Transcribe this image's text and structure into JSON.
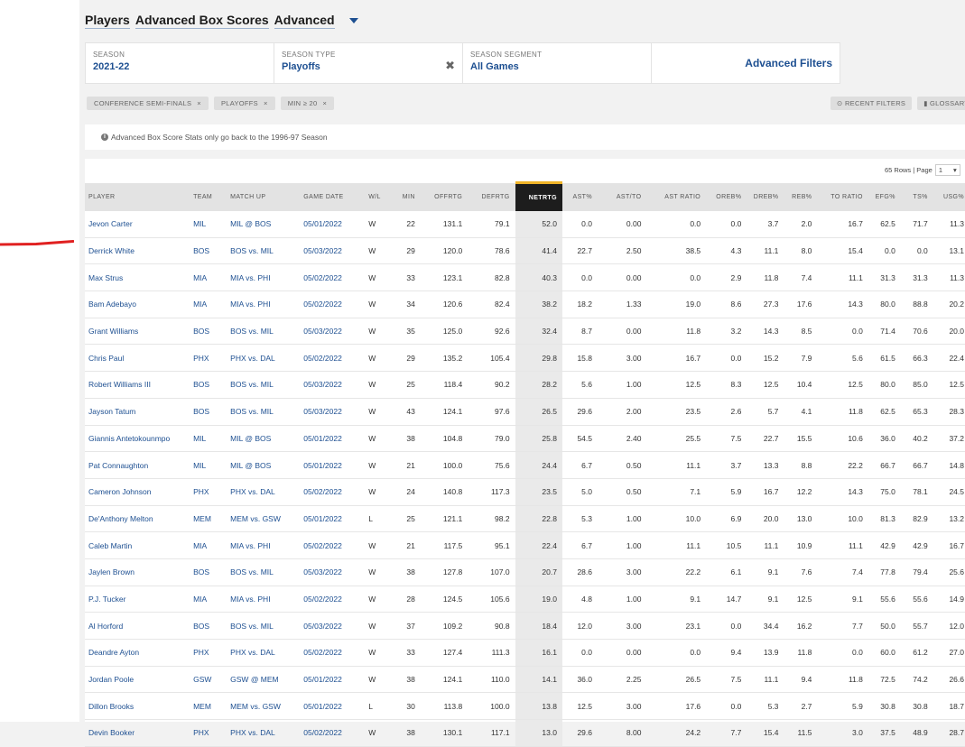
{
  "breadcrumbs": [
    "Players",
    "Advanced Box Scores",
    "Advanced"
  ],
  "filters": [
    {
      "label": "SEASON",
      "value": "2021-22"
    },
    {
      "label": "SEASON TYPE",
      "value": "Playoffs",
      "clear": "✖"
    },
    {
      "label": "SEASON SEGMENT",
      "value": "All Games"
    }
  ],
  "advanced_filters_label": "Advanced Filters",
  "chips": [
    "CONFERENCE SEMI-FINALS",
    "PLAYOFFS",
    "MIN ≥ 20"
  ],
  "chip_close": "×",
  "recent_filters_label": "⊙ RECENT FILTERS",
  "glossary_label": "▮ GLOSSARY",
  "note_icon": "i",
  "note": "Advanced Box Score Stats only go back to the 1996-97 Season",
  "pager": {
    "rows_text": "65 Rows | Page",
    "page": "1",
    "caret": "▾"
  },
  "columns": [
    "PLAYER",
    "TEAM",
    "MATCH UP",
    "GAME DATE",
    "W/L",
    "MIN",
    "OFFRTG",
    "DEFRTG",
    "NETRTG",
    "AST%",
    "AST/TO",
    "AST RATIO",
    "OREB%",
    "DREB%",
    "REB%",
    "TO RATIO",
    "EFG%",
    "TS%",
    "USG%"
  ],
  "rows": [
    [
      "Jevon Carter",
      "MIL",
      "MIL @ BOS",
      "05/01/2022",
      "W",
      "22",
      "131.1",
      "79.1",
      "52.0",
      "0.0",
      "0.00",
      "0.0",
      "0.0",
      "3.7",
      "2.0",
      "16.7",
      "62.5",
      "71.7",
      "11.3"
    ],
    [
      "Derrick White",
      "BOS",
      "BOS vs. MIL",
      "05/03/2022",
      "W",
      "29",
      "120.0",
      "78.6",
      "41.4",
      "22.7",
      "2.50",
      "38.5",
      "4.3",
      "11.1",
      "8.0",
      "15.4",
      "0.0",
      "0.0",
      "13.1"
    ],
    [
      "Max Strus",
      "MIA",
      "MIA vs. PHI",
      "05/02/2022",
      "W",
      "33",
      "123.1",
      "82.8",
      "40.3",
      "0.0",
      "0.00",
      "0.0",
      "2.9",
      "11.8",
      "7.4",
      "11.1",
      "31.3",
      "31.3",
      "11.3"
    ],
    [
      "Bam Adebayo",
      "MIA",
      "MIA vs. PHI",
      "05/02/2022",
      "W",
      "34",
      "120.6",
      "82.4",
      "38.2",
      "18.2",
      "1.33",
      "19.0",
      "8.6",
      "27.3",
      "17.6",
      "14.3",
      "80.0",
      "88.8",
      "20.2"
    ],
    [
      "Grant Williams",
      "BOS",
      "BOS vs. MIL",
      "05/03/2022",
      "W",
      "35",
      "125.0",
      "92.6",
      "32.4",
      "8.7",
      "0.00",
      "11.8",
      "3.2",
      "14.3",
      "8.5",
      "0.0",
      "71.4",
      "70.6",
      "20.0"
    ],
    [
      "Chris Paul",
      "PHX",
      "PHX vs. DAL",
      "05/02/2022",
      "W",
      "29",
      "135.2",
      "105.4",
      "29.8",
      "15.8",
      "3.00",
      "16.7",
      "0.0",
      "15.2",
      "7.9",
      "5.6",
      "61.5",
      "66.3",
      "22.4"
    ],
    [
      "Robert Williams III",
      "BOS",
      "BOS vs. MIL",
      "05/03/2022",
      "W",
      "25",
      "118.4",
      "90.2",
      "28.2",
      "5.6",
      "1.00",
      "12.5",
      "8.3",
      "12.5",
      "10.4",
      "12.5",
      "80.0",
      "85.0",
      "12.5"
    ],
    [
      "Jayson Tatum",
      "BOS",
      "BOS vs. MIL",
      "05/03/2022",
      "W",
      "43",
      "124.1",
      "97.6",
      "26.5",
      "29.6",
      "2.00",
      "23.5",
      "2.6",
      "5.7",
      "4.1",
      "11.8",
      "62.5",
      "65.3",
      "28.3"
    ],
    [
      "Giannis Antetokounmpo",
      "MIL",
      "MIL @ BOS",
      "05/01/2022",
      "W",
      "38",
      "104.8",
      "79.0",
      "25.8",
      "54.5",
      "2.40",
      "25.5",
      "7.5",
      "22.7",
      "15.5",
      "10.6",
      "36.0",
      "40.2",
      "37.2"
    ],
    [
      "Pat Connaughton",
      "MIL",
      "MIL @ BOS",
      "05/01/2022",
      "W",
      "21",
      "100.0",
      "75.6",
      "24.4",
      "6.7",
      "0.50",
      "11.1",
      "3.7",
      "13.3",
      "8.8",
      "22.2",
      "66.7",
      "66.7",
      "14.8"
    ],
    [
      "Cameron Johnson",
      "PHX",
      "PHX vs. DAL",
      "05/02/2022",
      "W",
      "24",
      "140.8",
      "117.3",
      "23.5",
      "5.0",
      "0.50",
      "7.1",
      "5.9",
      "16.7",
      "12.2",
      "14.3",
      "75.0",
      "78.1",
      "24.5"
    ],
    [
      "De'Anthony Melton",
      "MEM",
      "MEM vs. GSW",
      "05/01/2022",
      "L",
      "25",
      "121.1",
      "98.2",
      "22.8",
      "5.3",
      "1.00",
      "10.0",
      "6.9",
      "20.0",
      "13.0",
      "10.0",
      "81.3",
      "82.9",
      "13.2"
    ],
    [
      "Caleb Martin",
      "MIA",
      "MIA vs. PHI",
      "05/02/2022",
      "W",
      "21",
      "117.5",
      "95.1",
      "22.4",
      "6.7",
      "1.00",
      "11.1",
      "10.5",
      "11.1",
      "10.9",
      "11.1",
      "42.9",
      "42.9",
      "16.7"
    ],
    [
      "Jaylen Brown",
      "BOS",
      "BOS vs. MIL",
      "05/03/2022",
      "W",
      "38",
      "127.8",
      "107.0",
      "20.7",
      "28.6",
      "3.00",
      "22.2",
      "6.1",
      "9.1",
      "7.6",
      "7.4",
      "77.8",
      "79.4",
      "25.6"
    ],
    [
      "P.J. Tucker",
      "MIA",
      "MIA vs. PHI",
      "05/02/2022",
      "W",
      "28",
      "124.5",
      "105.6",
      "19.0",
      "4.8",
      "1.00",
      "9.1",
      "14.7",
      "9.1",
      "12.5",
      "9.1",
      "55.6",
      "55.6",
      "14.9"
    ],
    [
      "Al Horford",
      "BOS",
      "BOS vs. MIL",
      "05/03/2022",
      "W",
      "37",
      "109.2",
      "90.8",
      "18.4",
      "12.0",
      "3.00",
      "23.1",
      "0.0",
      "34.4",
      "16.2",
      "7.7",
      "50.0",
      "55.7",
      "12.0"
    ],
    [
      "Deandre Ayton",
      "PHX",
      "PHX vs. DAL",
      "05/02/2022",
      "W",
      "33",
      "127.4",
      "111.3",
      "16.1",
      "0.0",
      "0.00",
      "0.0",
      "9.4",
      "13.9",
      "11.8",
      "0.0",
      "60.0",
      "61.2",
      "27.0"
    ],
    [
      "Jordan Poole",
      "GSW",
      "GSW @ MEM",
      "05/01/2022",
      "W",
      "38",
      "124.1",
      "110.0",
      "14.1",
      "36.0",
      "2.25",
      "26.5",
      "7.5",
      "11.1",
      "9.4",
      "11.8",
      "72.5",
      "74.2",
      "26.6"
    ],
    [
      "Dillon Brooks",
      "MEM",
      "MEM vs. GSW",
      "05/01/2022",
      "L",
      "30",
      "113.8",
      "100.0",
      "13.8",
      "12.5",
      "3.00",
      "17.6",
      "0.0",
      "5.3",
      "2.7",
      "5.9",
      "30.8",
      "30.8",
      "18.7"
    ],
    [
      "Devin Booker",
      "PHX",
      "PHX vs. DAL",
      "05/02/2022",
      "W",
      "38",
      "130.1",
      "117.1",
      "13.0",
      "29.6",
      "8.00",
      "24.2",
      "7.7",
      "15.4",
      "11.5",
      "3.0",
      "37.5",
      "48.9",
      "28.7"
    ]
  ],
  "colors": {
    "link": "#1d4f91",
    "netrtg_header": "#1d1d1d",
    "netrtg_accent": "#f0b429",
    "annotation_mark": "#e02020"
  }
}
